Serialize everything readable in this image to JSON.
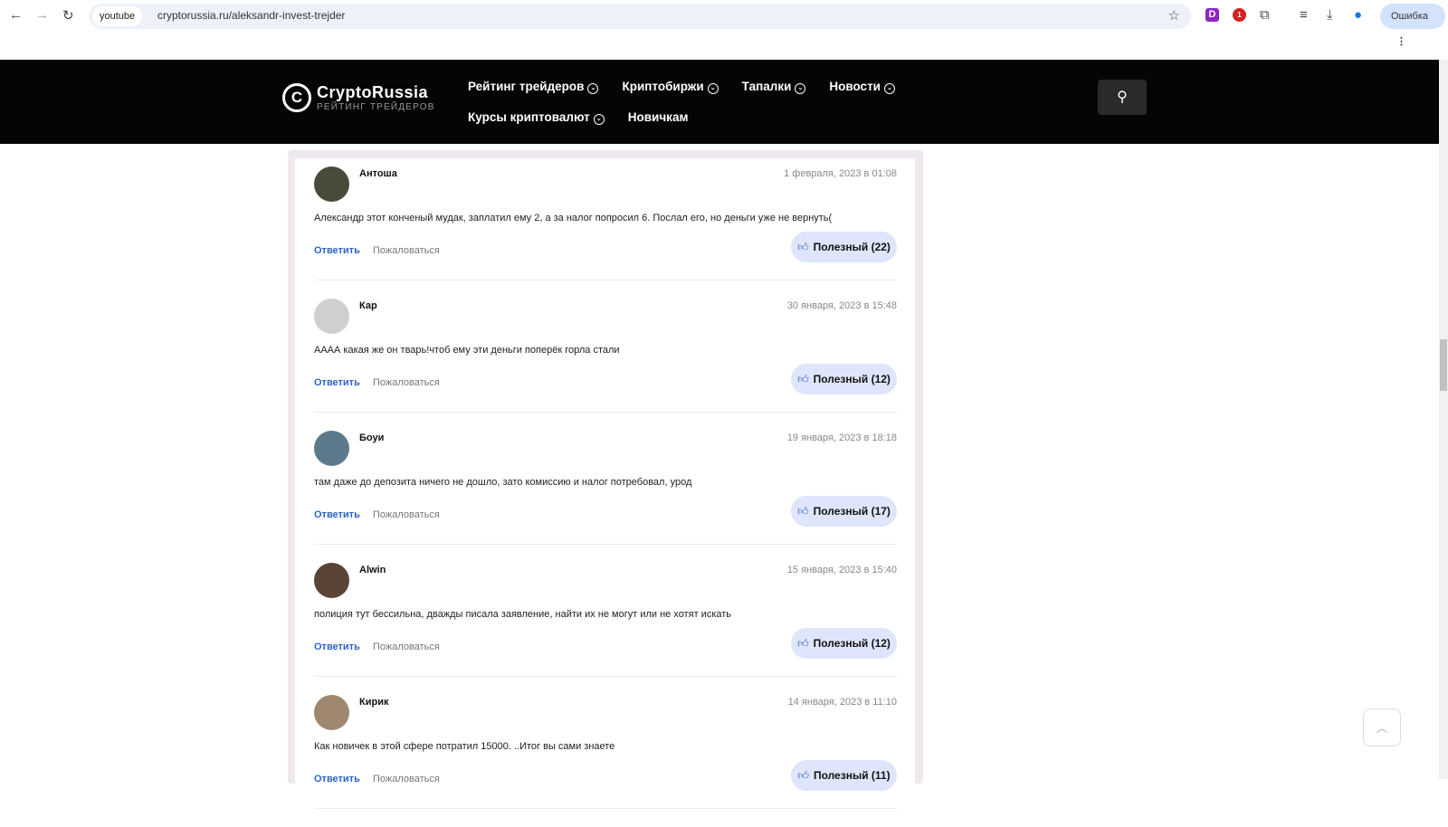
{
  "browser": {
    "site_chip": "youtube",
    "url": "cryptorussia.ru/aleksandr-invest-trejder",
    "profile_status": "Ошибка",
    "ext_badge": "1"
  },
  "site": {
    "logo_title": "CryptoRussia",
    "logo_subtitle": "РЕЙТИНГ ТРЕЙДЕРОВ",
    "menu": [
      {
        "label": "Рейтинг трейдеров",
        "dropdown": true
      },
      {
        "label": "Криптобиржи",
        "dropdown": true
      },
      {
        "label": "Тапалки",
        "dropdown": true
      },
      {
        "label": "Новости",
        "dropdown": true
      },
      {
        "label": "Курсы криптовалют",
        "dropdown": true
      },
      {
        "label": "Новичкам",
        "dropdown": false
      }
    ]
  },
  "comments": [
    {
      "name": "Антоша",
      "date": "1 февраля, 2023 в 01:08",
      "text": "Александр этот конченый мудак, заплатил ему 2, а за налог попросил 6. Послал его, но деньги уже не вернуть(",
      "reply": "Ответить",
      "report": "Пожаловаться",
      "useful": "Полезный (22)",
      "avatar_color": "#4a4a3a"
    },
    {
      "name": "Кар",
      "date": "30 января, 2023 в 15:48",
      "text": "АААА какая же он тварь!чтоб ему эти деньги поперёк горла стали",
      "reply": "Ответить",
      "report": "Пожаловаться",
      "useful": "Полезный (12)",
      "avatar_color": "#cfcfcf"
    },
    {
      "name": "Боуи",
      "date": "19 января, 2023 в 18:18",
      "text": "там даже до депозита ничего не дошло, зато комиссию и налог потребовал, урод",
      "reply": "Ответить",
      "report": "Пожаловаться",
      "useful": "Полезный (17)",
      "avatar_color": "#5c7a8c"
    },
    {
      "name": "Alwin",
      "date": "15 января, 2023 в 15:40",
      "text": "полиция тут бессильна, дважды писала заявление, найти их не могут или не хотят искать",
      "reply": "Ответить",
      "report": "Пожаловаться",
      "useful": "Полезный (12)",
      "avatar_color": "#5a4438"
    },
    {
      "name": "Кирик",
      "date": "14 января, 2023 в 11:10",
      "text": "Как новичек в этой сфере потратил 15000. ..Итог вы сами знаете",
      "reply": "Ответить",
      "report": "Пожаловаться",
      "useful": "Полезный (11)",
      "avatar_color": "#a08870"
    }
  ]
}
